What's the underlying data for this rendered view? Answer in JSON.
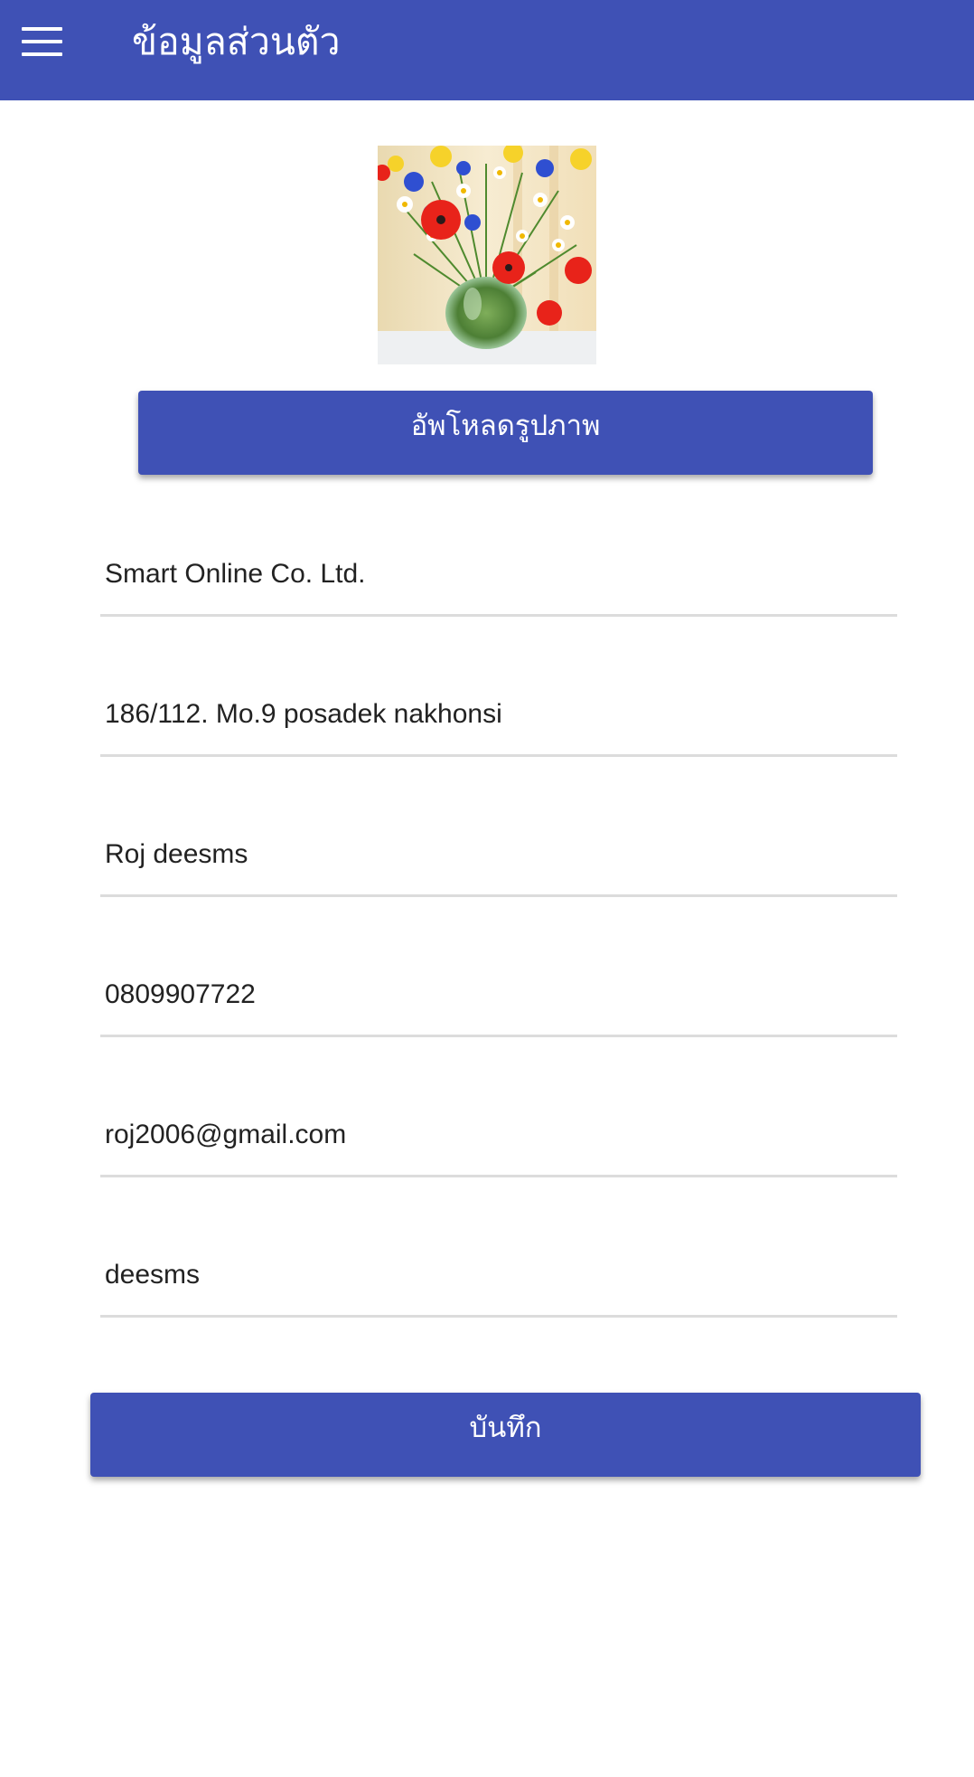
{
  "header": {
    "title": "ข้อมูลส่วนตัว",
    "menu_icon": "hamburger-menu-icon",
    "background": "#3f51b5"
  },
  "profile": {
    "photo": "flower-vase-photo",
    "upload_label": "อัพโหลดรูปภาพ"
  },
  "form": {
    "company": "Smart Online Co. Ltd.",
    "address": "186/112. Mo.9 posadek nakhonsi",
    "name": "Roj deesms",
    "phone": "0809907722",
    "email": "roj2006@gmail.com",
    "username": "deesms"
  },
  "actions": {
    "save_label": "บันทึก"
  },
  "colors": {
    "primary": "#3f51b5",
    "underline": "#dcdcdc",
    "text": "#222222"
  }
}
